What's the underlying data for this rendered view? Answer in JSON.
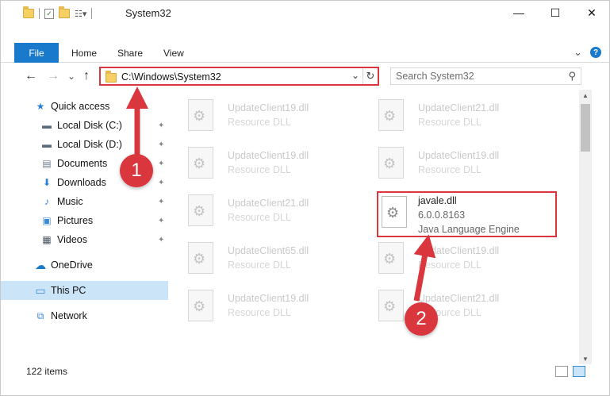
{
  "window": {
    "title": "System32",
    "minimize_glyph": "—",
    "maximize_glyph": "☐",
    "close_glyph": "✕"
  },
  "ribbon": {
    "tabs": [
      {
        "label": "File",
        "active": true
      },
      {
        "label": "Home"
      },
      {
        "label": "Share"
      },
      {
        "label": "View"
      }
    ],
    "expand_glyph": "⌄",
    "help_glyph": "?"
  },
  "navigation": {
    "back_glyph": "←",
    "forward_glyph": "→",
    "recent_glyph": "⌄",
    "up_glyph": "↑",
    "address_path": "C:\\Windows\\System32",
    "address_dropdown_glyph": "⌄",
    "refresh_glyph": "↻",
    "search_placeholder": "Search System32",
    "search_glyph": "⚲"
  },
  "sidebar": {
    "items": [
      {
        "label": "Quick access",
        "icon": "star-icon",
        "glyph": "★",
        "color": "#2f7fd6",
        "pinned": false
      },
      {
        "label": "Local Disk (C:)",
        "icon": "drive-icon",
        "glyph": "▬",
        "color": "#5a6b7b",
        "pinned": true
      },
      {
        "label": "Local Disk (D:)",
        "icon": "drive-icon",
        "glyph": "▬",
        "color": "#5a6b7b",
        "pinned": true
      },
      {
        "label": "Documents",
        "icon": "documents-icon",
        "glyph": "▤",
        "color": "#6e7d8c",
        "pinned": true
      },
      {
        "label": "Downloads",
        "icon": "downloads-icon",
        "glyph": "⬇",
        "color": "#2f7fd6",
        "pinned": true
      },
      {
        "label": "Music",
        "icon": "music-icon",
        "glyph": "♪",
        "color": "#2f7fd6",
        "pinned": true
      },
      {
        "label": "Pictures",
        "icon": "pictures-icon",
        "glyph": "▣",
        "color": "#3b8ad8",
        "pinned": true
      },
      {
        "label": "Videos",
        "icon": "videos-icon",
        "glyph": "▦",
        "color": "#4a5562",
        "pinned": true
      },
      {
        "label": "OneDrive",
        "icon": "cloud-icon",
        "glyph": "☁",
        "color": "#1979ca",
        "pinned": false
      },
      {
        "label": "This PC",
        "icon": "computer-icon",
        "glyph": "▭",
        "color": "#3b8ad8",
        "pinned": false,
        "selected": true
      },
      {
        "label": "Network",
        "icon": "network-icon",
        "glyph": "⧉",
        "color": "#3b8ad8",
        "pinned": false
      }
    ],
    "pin_glyph": "📌"
  },
  "files": [
    {
      "name": "UpdateClient19.dll",
      "desc": "Resource DLL"
    },
    {
      "name": "UpdateClient21.dll",
      "desc": "Resource DLL"
    },
    {
      "name": "UpdateClient19.dll",
      "desc": "Resource DLL"
    },
    {
      "name": "UpdateClient19.dll",
      "desc": "Resource DLL"
    },
    {
      "name": "UpdateClient21.dll",
      "desc": "Resource DLL"
    },
    {
      "name": "javale.dll",
      "version": "6.0.0.8163",
      "desc": "Java Language Engine",
      "highlighted": true
    },
    {
      "name": "UpdateClient65.dll",
      "desc": "Resource DLL"
    },
    {
      "name": "UpdateClient19.dll",
      "desc": "Resource DLL"
    },
    {
      "name": "UpdateClient19.dll",
      "desc": "Resource DLL"
    },
    {
      "name": "UpdateClient21.dll",
      "desc": "Resource DLL"
    }
  ],
  "status": {
    "item_count": "122 items"
  },
  "annotations": {
    "step1": "1",
    "step2": "2",
    "color": "#d9363e"
  }
}
